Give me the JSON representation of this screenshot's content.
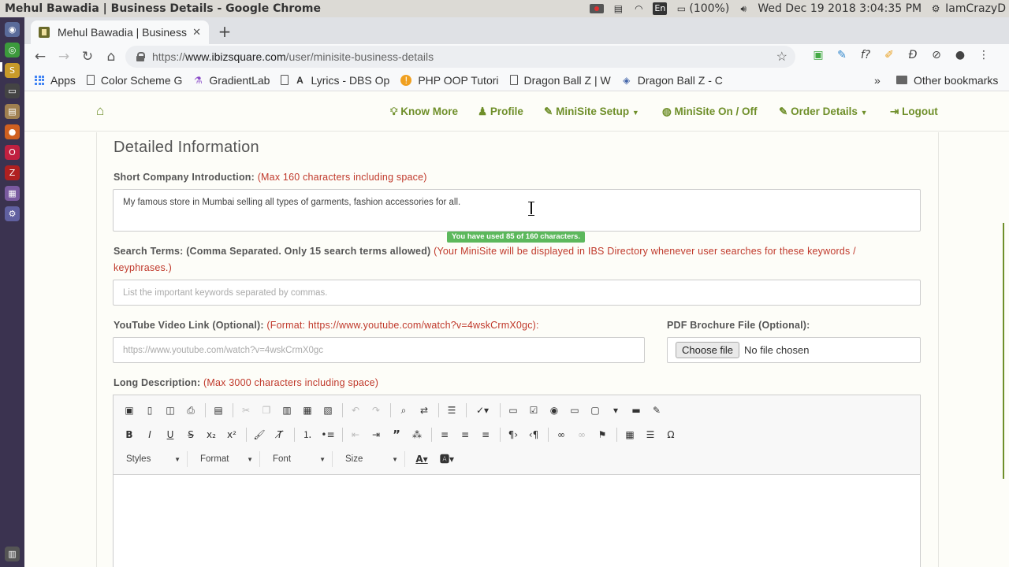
{
  "os": {
    "window_title": "Mehul Bawadia | Business Details - Google Chrome",
    "keyboard": "En",
    "battery": "(100%)",
    "datetime": "Wed Dec 19 2018  3:04:35 PM",
    "user": "IamCrazyD"
  },
  "browser": {
    "tab_title": "Mehul Bawadia | Business",
    "url_scheme": "https://",
    "url_host": "www.ibizsquare.com",
    "url_path": "/user/minisite-business-details",
    "bookmarks": [
      "Apps",
      "Color Scheme G",
      "GradientLab",
      "Lyrics - DBS Op",
      "PHP OOP Tutori",
      "Dragon Ball Z | W",
      "Dragon Ball Z - C"
    ],
    "bookmarks_overflow": "»",
    "other_bookmarks": "Other bookmarks"
  },
  "site_nav": {
    "know_more": "Know More",
    "profile": "Profile",
    "minisite_setup": "MiniSite Setup",
    "minisite_onoff": "MiniSite On / Off",
    "order_details": "Order Details",
    "logout": "Logout"
  },
  "form": {
    "section_title": "Detailed Information",
    "short_intro_label": "Short Company Introduction:",
    "short_intro_hint": "(Max 160 characters including space)",
    "short_intro_value": "My famous store in Mumbai selling all types of garments, fashion accessories for all.",
    "counter_text": "You have used 85 of 160 characters.",
    "search_terms_label": "Search Terms: (Comma Separated. Only 15 search terms allowed)",
    "search_terms_hint_1": "(Your MiniSite will be displayed in IBS Directory whenever user searches for these keywords /",
    "search_terms_hint_2": "keyphrases.)",
    "search_terms_placeholder": "List the important keywords separated by commas.",
    "youtube_label": "YouTube Video Link (Optional):",
    "youtube_hint": "(Format: https://www.youtube.com/watch?v=4wskCrmX0gc):",
    "youtube_placeholder": "https://www.youtube.com/watch?v=4wskCrmX0gc",
    "pdf_label": "PDF Brochure File (Optional):",
    "choose_file": "Choose file",
    "no_file": "No file chosen",
    "long_desc_label": "Long Description:",
    "long_desc_hint": "(Max 3000 characters including space)"
  },
  "editor": {
    "styles": "Styles",
    "format": "Format",
    "font": "Font",
    "size": "Size"
  },
  "colors": {
    "accent_green": "#6f8f2a",
    "hint_red": "#c0392b",
    "counter_green": "#5cb85c"
  }
}
